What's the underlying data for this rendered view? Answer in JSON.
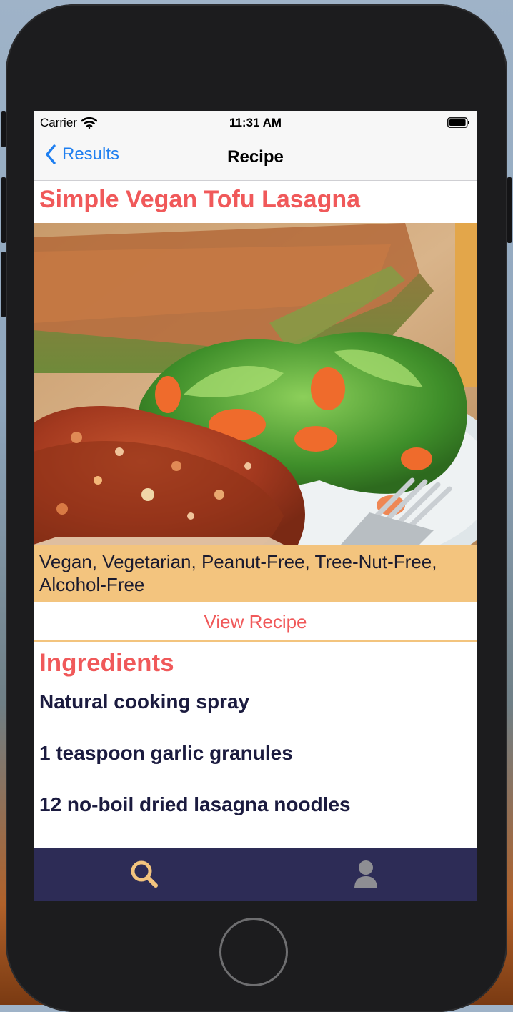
{
  "status_bar": {
    "carrier": "Carrier",
    "time": "11:31 AM"
  },
  "nav": {
    "back_label": "Results",
    "title": "Recipe"
  },
  "recipe": {
    "title": "Simple Vegan Tofu Lasagna",
    "health_labels": "Vegan, Vegetarian, Peanut-Free, Tree-Nut-Free, Alcohol-Free",
    "view_recipe_label": "View Recipe",
    "ingredients_header": "Ingredients",
    "ingredients": [
      "Natural cooking spray",
      "1 teaspoon garlic granules",
      "12 no-boil dried lasagna noodles"
    ]
  },
  "tabbar": {
    "items": [
      {
        "icon": "search-icon",
        "active": true
      },
      {
        "icon": "profile-icon",
        "active": false
      }
    ]
  },
  "colors": {
    "accent": "#f0595a",
    "label_bg": "#f3c47e",
    "tabbar_bg": "#2d2c56",
    "tab_active": "#f3c47e",
    "tab_inactive": "#8e8e93",
    "link": "#1f7ff0",
    "ingredient_text": "#1b1b3f"
  }
}
